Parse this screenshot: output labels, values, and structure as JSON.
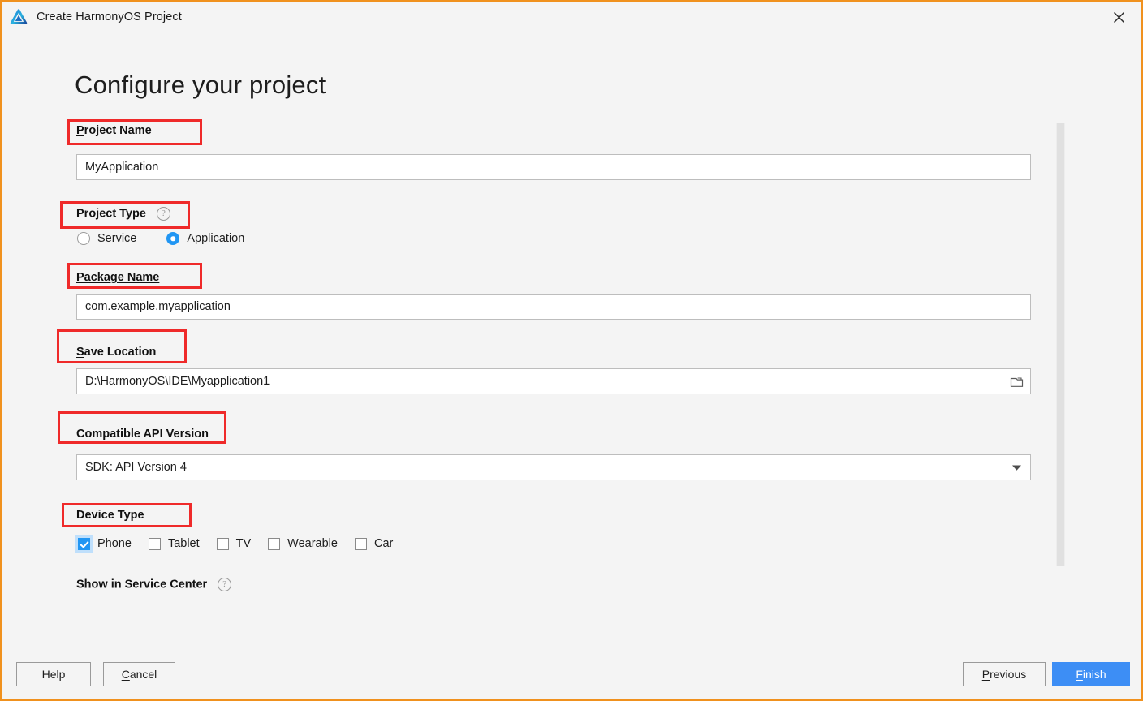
{
  "window": {
    "title": "Create HarmonyOS Project",
    "logo_icon": "harmonyos-triangle-logo",
    "close_icon": "close-icon",
    "border_color": "#f0911e",
    "background": "#f4f4f4"
  },
  "page": {
    "heading": "Configure your project"
  },
  "fields": {
    "project_name": {
      "label": "Project Name",
      "mnemonic": "P",
      "value": "MyApplication"
    },
    "project_type": {
      "label": "Project Type",
      "help_icon": "question-mark-icon",
      "options": [
        {
          "label": "Service",
          "selected": false
        },
        {
          "label": "Application",
          "selected": true
        }
      ]
    },
    "package_name": {
      "label": "Package Name",
      "value": "com.example.myapplication"
    },
    "save_location": {
      "label": "Save Location",
      "mnemonic": "S",
      "value": "D:\\HarmonyOS\\IDE\\Myapplication1",
      "browse_icon": "folder-icon"
    },
    "compatible_api_version": {
      "label": "Compatible API Version",
      "value": "SDK: API Version 4",
      "dropdown_icon": "chevron-down-icon"
    },
    "device_type": {
      "label": "Device Type",
      "options": [
        {
          "label": "Phone",
          "checked": true
        },
        {
          "label": "Tablet",
          "checked": false
        },
        {
          "label": "TV",
          "checked": false
        },
        {
          "label": "Wearable",
          "checked": false
        },
        {
          "label": "Car",
          "checked": false
        }
      ]
    },
    "show_in_service_center": {
      "label": "Show in Service Center",
      "help_icon": "question-mark-icon"
    }
  },
  "footer": {
    "help": "Help",
    "cancel": "Cancel",
    "cancel_mnemonic": "C",
    "previous": "Previous",
    "previous_mnemonic": "P",
    "finish": "Finish",
    "finish_mnemonic": "F",
    "primary_color": "#3d8ef5"
  },
  "annotations": {
    "color": "#ef2a2a",
    "boxes": [
      "project-name-label",
      "project-type-label",
      "package-name-label",
      "save-location-label",
      "compatible-api-version-label",
      "device-type-label"
    ]
  }
}
